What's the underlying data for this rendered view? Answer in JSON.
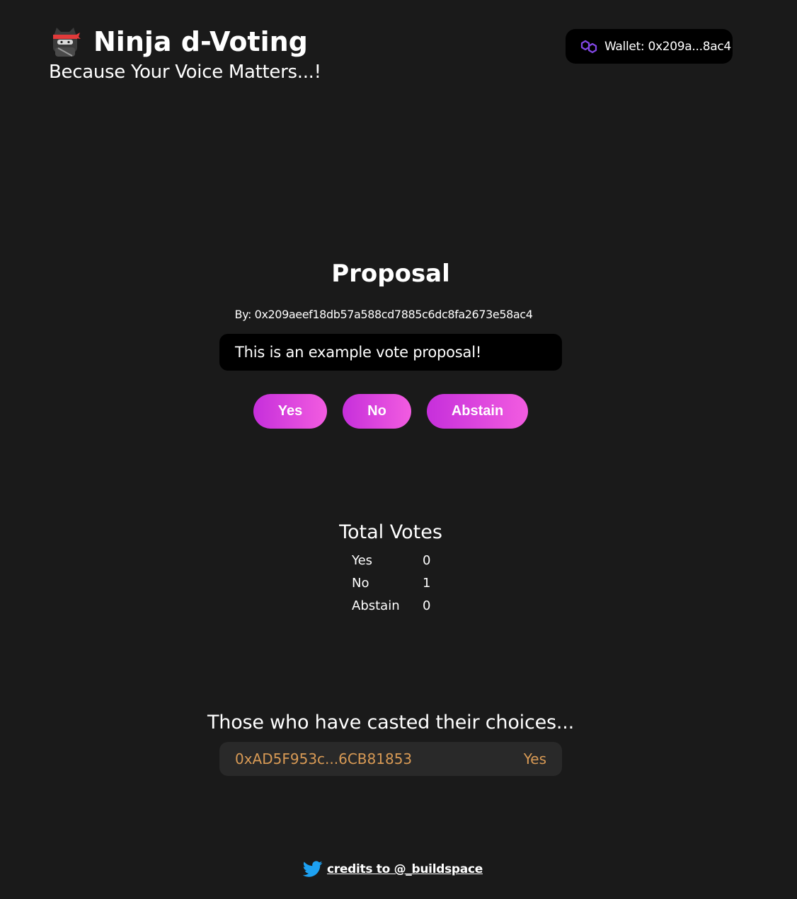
{
  "header": {
    "title": "Ninja d-Voting",
    "tagline": "Because Your Voice Matters...!",
    "logo_icon": "ninja-cat-icon"
  },
  "wallet": {
    "label": "Wallet: 0x209a...8ac4",
    "icon": "polygon-icon"
  },
  "proposal": {
    "title": "Proposal",
    "by": "By: 0x209aeef18db57a588cd7885c6dc8fa2673e58ac4",
    "text": "This is an example vote proposal!"
  },
  "vote_buttons": {
    "yes": "Yes",
    "no": "No",
    "abstain": "Abstain"
  },
  "totals": {
    "title": "Total Votes",
    "rows": [
      {
        "label": "Yes",
        "count": "0"
      },
      {
        "label": "No",
        "count": "1"
      },
      {
        "label": "Abstain",
        "count": "0"
      }
    ]
  },
  "voters": {
    "title": "Those who have casted their choices...",
    "items": [
      {
        "address": "0xAD5F953c...6CB81853",
        "choice": "Yes"
      }
    ]
  },
  "footer": {
    "link_text": "credits to @_buildspace",
    "icon": "twitter-icon"
  },
  "colors": {
    "background": "#1a1a1a",
    "button_gradient_start": "#c62fdb",
    "button_gradient_end": "#f25ce0",
    "voter_text": "#d89a55",
    "polygon_purple": "#8247e5",
    "twitter_blue": "#1da1f2"
  }
}
